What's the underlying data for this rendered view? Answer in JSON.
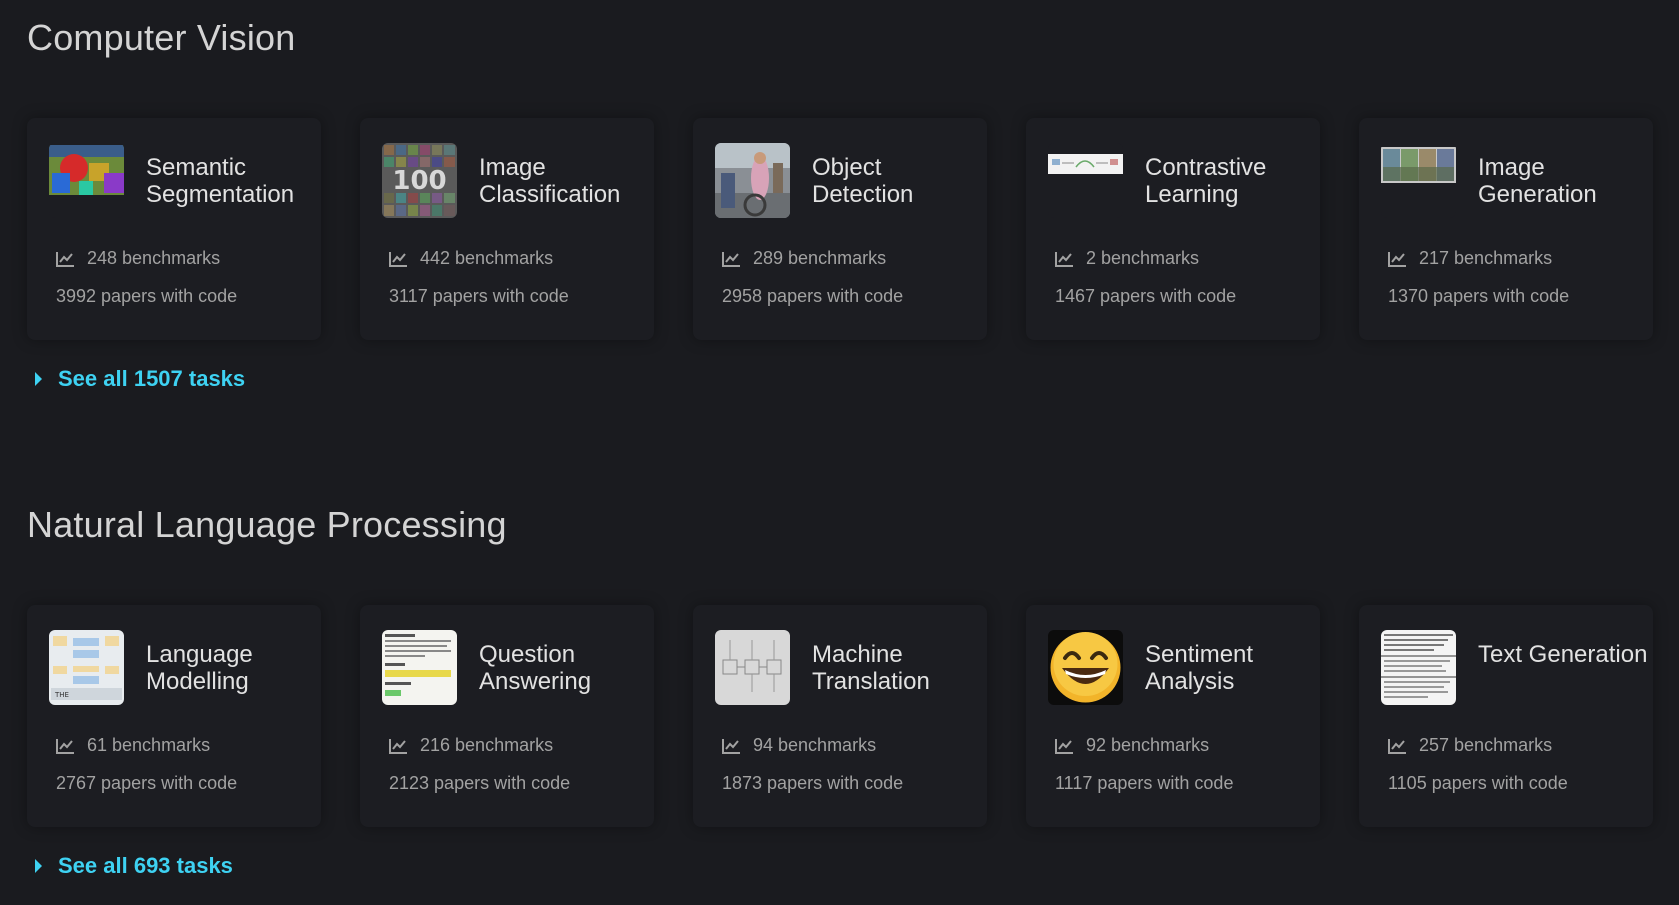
{
  "sections": [
    {
      "title": "Computer Vision",
      "see_all": "See all 1507 tasks",
      "tasks": [
        {
          "title": "Semantic Segmentation",
          "benchmarks": "248 benchmarks",
          "papers": "3992 papers with code",
          "image": "segmentation-thumbnail"
        },
        {
          "title": "Image Classification",
          "benchmarks": "442 benchmarks",
          "papers": "3117 papers with code",
          "image": "image-grid-thumbnail"
        },
        {
          "title": "Object Detection",
          "benchmarks": "289 benchmarks",
          "papers": "2958 papers with code",
          "image": "street-photo-thumbnail"
        },
        {
          "title": "Contrastive Learning",
          "benchmarks": "2 benchmarks",
          "papers": "1467 papers with code",
          "image": "diagram-thumbnail"
        },
        {
          "title": "Image Generation",
          "benchmarks": "217 benchmarks",
          "papers": "1370 papers with code",
          "image": "landscape-thumbnail"
        }
      ]
    },
    {
      "title": "Natural Language Processing",
      "see_all": "See all 693 tasks",
      "tasks": [
        {
          "title": "Language Modelling",
          "benchmarks": "61 benchmarks",
          "papers": "2767 papers with code",
          "image": "model-diagram-thumbnail"
        },
        {
          "title": "Question Answering",
          "benchmarks": "216 benchmarks",
          "papers": "2123 papers with code",
          "image": "qa-text-thumbnail"
        },
        {
          "title": "Machine Translation",
          "benchmarks": "94 benchmarks",
          "papers": "1873 papers with code",
          "image": "seq2seq-thumbnail"
        },
        {
          "title": "Sentiment Analysis",
          "benchmarks": "92 benchmarks",
          "papers": "1117 papers with code",
          "image": "smiley-emoji-thumbnail"
        },
        {
          "title": "Text Generation",
          "benchmarks": "257 benchmarks",
          "papers": "1105 papers with code",
          "image": "text-page-thumbnail"
        }
      ]
    }
  ],
  "colors": {
    "background": "#1a1b1f",
    "card": "#1c1d22",
    "link": "#3ed2f2",
    "title": "#e2e2e2",
    "muted": "#a2a2a2"
  },
  "icons": {
    "stat": "line-chart-icon",
    "see_all": "caret-right-icon"
  }
}
